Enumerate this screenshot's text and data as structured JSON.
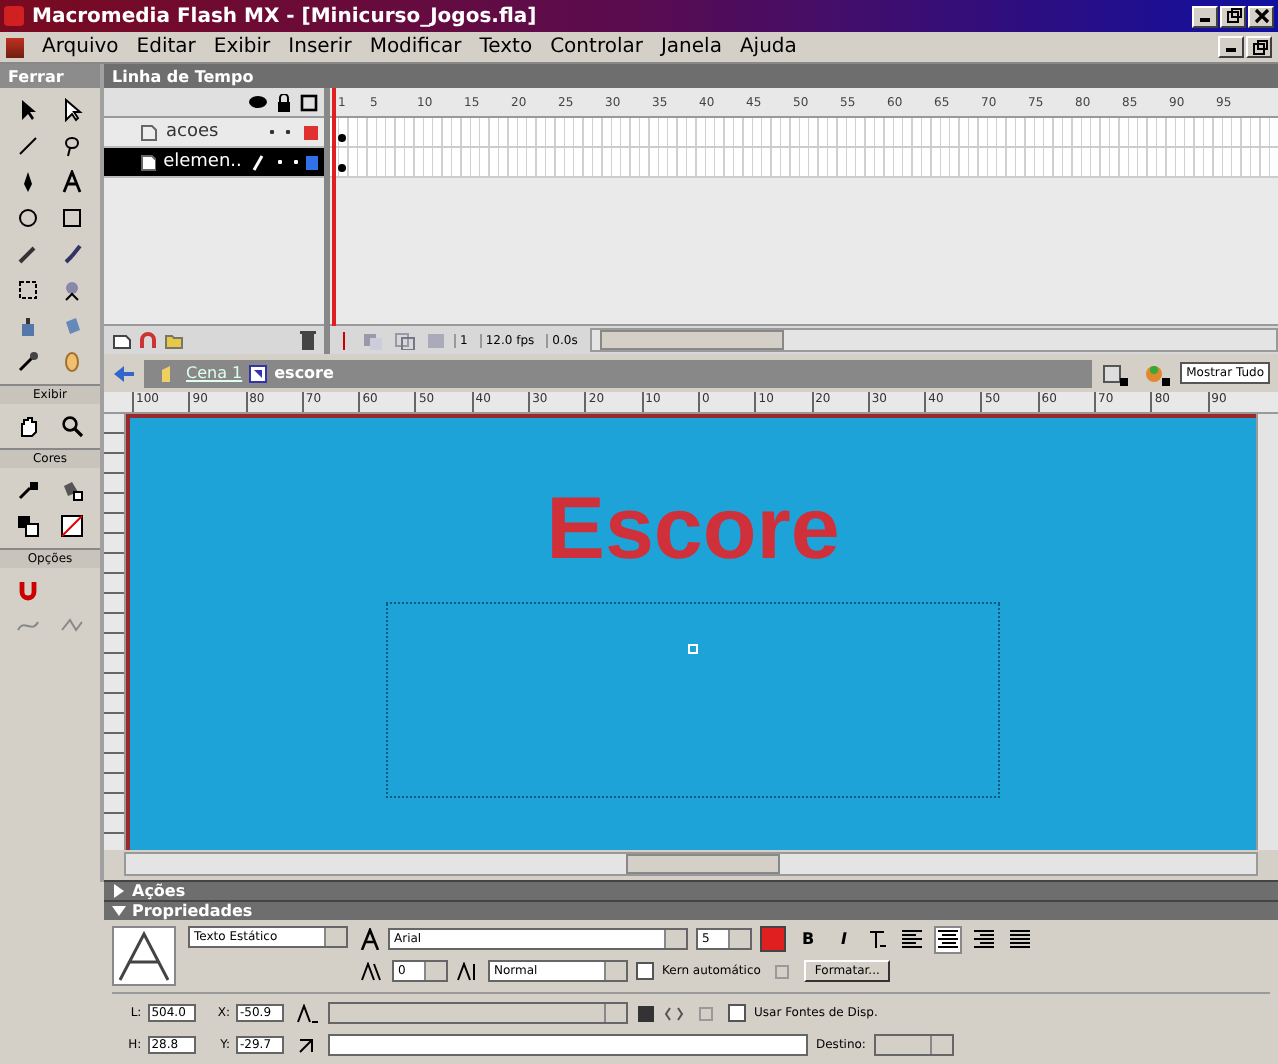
{
  "window": {
    "title": "Macromedia Flash MX - [Minicurso_Jogos.fla]"
  },
  "menu": [
    "Arquivo",
    "Editar",
    "Exibir",
    "Inserir",
    "Modificar",
    "Texto",
    "Controlar",
    "Janela",
    "Ajuda"
  ],
  "toolbox": {
    "title": "Ferrar",
    "sections": [
      "Exibir",
      "Cores",
      "Opções"
    ]
  },
  "timeline": {
    "title": "Linha de Tempo",
    "frame_numbers": [
      "1",
      "5",
      "10",
      "15",
      "20",
      "25",
      "30",
      "35",
      "40",
      "45",
      "50",
      "55",
      "60",
      "65",
      "70",
      "75",
      "80",
      "85",
      "90",
      "95"
    ],
    "layers": [
      {
        "name": "acoes",
        "selected": false,
        "color": "#e03030"
      },
      {
        "name": "elemen..",
        "selected": true,
        "color": "#3070e8"
      }
    ],
    "current_frame": "1",
    "frame_rate": "12.0 fps",
    "elapsed": "0.0s"
  },
  "edit_bar": {
    "scenes": [
      "Cena 1",
      "escore"
    ],
    "zoom": "Mostrar Tudo"
  },
  "ruler": [
    "100",
    "90",
    "80",
    "70",
    "60",
    "50",
    "40",
    "30",
    "20",
    "10",
    "0",
    "10",
    "20",
    "30",
    "40",
    "50",
    "60",
    "70",
    "80",
    "90"
  ],
  "stage": {
    "text": "Escore"
  },
  "panels": [
    {
      "title": "Ações",
      "expanded": false
    },
    {
      "title": "Propriedades",
      "expanded": true
    }
  ],
  "properties": {
    "text_type": "Texto Estático",
    "font": "Arial",
    "size": "5",
    "color": "#e02020",
    "bold_button": "B",
    "italic_button": "I",
    "align": [
      {
        "selected": false
      },
      {
        "selected": true
      },
      {
        "selected": false
      },
      {
        "selected": false
      }
    ],
    "letter_spacing": "0",
    "baseline": "Normal",
    "kern": {
      "label": "Kern automático",
      "checked": false
    },
    "format_button": "Formatar...",
    "dims": [
      {
        "label": "L:",
        "value": "504.0"
      },
      {
        "label": "X:",
        "value": "-50.9"
      },
      {
        "label": "H:",
        "value": "28.8"
      },
      {
        "label": "Y:",
        "value": "-29.7"
      }
    ],
    "device_fonts": {
      "label": "Usar Fontes de Disp.",
      "checked": false
    },
    "target_label": "Destino:"
  }
}
